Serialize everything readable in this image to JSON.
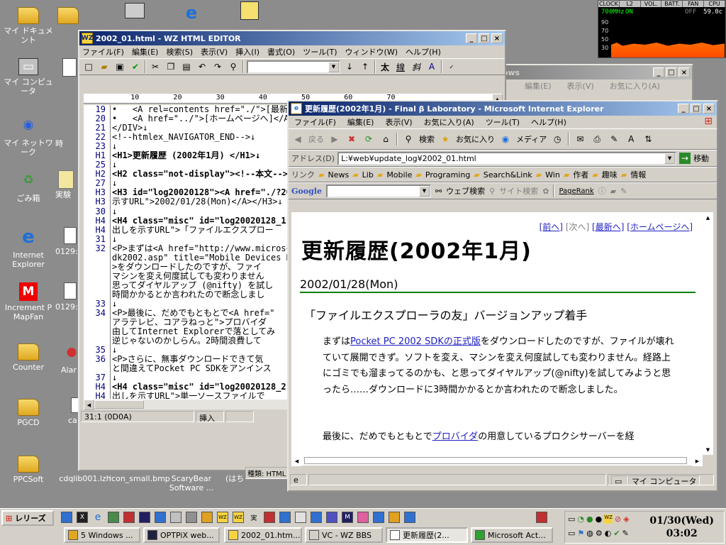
{
  "desktop": {
    "icons": [
      {
        "label": "マイ ドキュメント",
        "icon": "my-documents-icon"
      },
      {
        "label": "マイ コンピュータ",
        "icon": "my-computer-icon"
      },
      {
        "label": "マイ ネットワーク",
        "icon": "my-network-icon"
      },
      {
        "label": "ごみ箱",
        "icon": "recycle-bin-icon"
      },
      {
        "label": "Internet Explorer",
        "icon": "internet-explorer-icon"
      },
      {
        "label": "Increment P MapFan",
        "icon": "mapfan-icon"
      },
      {
        "label": "Counter",
        "icon": "folder-icon"
      },
      {
        "label": "PGCD",
        "icon": "folder-icon"
      },
      {
        "label": "PPCSoft",
        "icon": "folder-icon"
      }
    ],
    "icons2": [
      {
        "label": "時",
        "icon": "folder-icon"
      },
      {
        "label": "実験",
        "icon": "folder-icon"
      },
      {
        "label": "0129:",
        "icon": "file-icon"
      },
      {
        "label": "0129:",
        "icon": "file-icon"
      },
      {
        "label": "Alar",
        "icon": "alarm-icon"
      },
      {
        "label": "ca",
        "icon": "file-icon"
      },
      {
        "label": "cdqlib001.lzh",
        "icon": "archive-icon"
      }
    ],
    "icons3": [
      {
        "label": "icon_small.bmp",
        "icon": "bitmap-icon"
      },
      {
        "label": "ScaryBear Software ...",
        "icon": "scarybear-icon"
      },
      {
        "label": "(はち",
        "icon": "file-icon"
      }
    ]
  },
  "monitor": {
    "cols": [
      "CLOCK",
      "L2",
      "VOL.",
      "BATT.",
      "FAN",
      "CPU"
    ],
    "clock": "700MHz",
    "l2": "ON",
    "fan": "OFF",
    "cpu": "59.0c",
    "scale": [
      "90",
      "70",
      "50",
      "30"
    ]
  },
  "editor": {
    "title": "2002_01.html - WZ HTML EDITOR",
    "menu": [
      "ファイル(F)",
      "編集(E)",
      "検索(S)",
      "表示(V)",
      "挿入(I)",
      "書式(O)",
      "ツール(T)",
      "ウィンドウ(W)",
      "ヘルプ(H)"
    ],
    "ruler": "           10        20        30        40        50        60        70",
    "lines": [
      {
        "no": "19",
        "text": "•   <A rel=contents href=\"./\">[最新へ]</A>↓"
      },
      {
        "no": "20",
        "text": "•   <A href=\"../\">[ホームページへ]</A>"
      },
      {
        "no": "21",
        "text": "</DIV>↓"
      },
      {
        "no": "22",
        "text": "<!--htmlex_NAVIGATOR_END-->↓"
      },
      {
        "no": "23",
        "text": "↓"
      },
      {
        "no": "H1",
        "text": "<H1>更新履歴 (2002年1月) </H1>↓"
      },
      {
        "no": "25",
        "text": "↓"
      },
      {
        "no": "H2",
        "text": "<H2 class=\"not-display\"><!--本文-->"
      },
      {
        "no": "27",
        "text": "↓"
      },
      {
        "no": "H3",
        "text": "<H3 id=\"log20020128\"><A href=\"./?200"
      },
      {
        "no": "H3",
        "text": "示すURL\">2002/01/28(Mon)</A></H3>↓"
      },
      {
        "no": "30",
        "text": "↓"
      },
      {
        "no": "H4",
        "text": "<H4 class=\"misc\" id=\"log20020128_1\">"
      },
      {
        "no": "H4",
        "text": "出しを示すURL\">「ファイルエクスプロー"
      },
      {
        "no": "31",
        "text": "↓"
      },
      {
        "no": "32",
        "text": "<P>まずは<A href=\"http://www.microsc"
      },
      {
        "no": "",
        "text": "dk2002.asp\" title=\"Mobile Devices Do"
      },
      {
        "no": "",
        "text": ">をダウンロードしたのですが、ファイ"
      },
      {
        "no": "",
        "text": "マシンを変え何度試しても変わりません"
      },
      {
        "no": "",
        "text": "思ってダイヤルアップ (@nifty) を試し"
      },
      {
        "no": "",
        "text": "時間かかるとか言われたので断念しまし"
      },
      {
        "no": "33",
        "text": "↓"
      },
      {
        "no": "34",
        "text": "<P>最後に、だめでもともとで<A href=\""
      },
      {
        "no": "",
        "text": "アラテレビ、コアラねっと\">プロバイダ"
      },
      {
        "no": "",
        "text": "由してInternet Explorerで落としてみ"
      },
      {
        "no": "",
        "text": "逆じゃないのかしらん。2時間浪費して"
      },
      {
        "no": "35",
        "text": "↓"
      },
      {
        "no": "36",
        "text": "<P>さらに、無事ダウンロードできて気"
      },
      {
        "no": "",
        "text": "と間違えてPocket PC SDKをアンインス"
      },
      {
        "no": "37",
        "text": "↓"
      },
      {
        "no": "H4",
        "text": "<H4 class=\"misc\" id=\"log20020128_2\">"
      },
      {
        "no": "H4",
        "text": "出しを示すURL\">単一ソースファイルで"
      },
      {
        "no": "",
        "text": "</A></H4>↓"
      }
    ],
    "status": {
      "pos": "31:1 (0D0A)",
      "mode": "挿入"
    }
  },
  "back_window": {
    "title": "lows",
    "menu": [
      "編集(E)",
      "表示(V)",
      "お気に入り(A)"
    ]
  },
  "ie": {
    "title": "更新履歴(2002年1月) - Final β Laboratory - Microsoft Internet Explorer",
    "menu": [
      "ファイル(F)",
      "編集(E)",
      "表示(V)",
      "お気に入り(A)",
      "ツール(T)",
      "ヘルプ(H)"
    ],
    "toolbar": {
      "back": "戻る",
      "search": "検索",
      "favorites": "お気に入り",
      "media": "メディア"
    },
    "address_label": "アドレス(D)",
    "address": "L:¥web¥update_log¥2002_01.html",
    "go": "移動",
    "links_label": "リンク",
    "links": [
      "News",
      "Lib",
      "Mobile",
      "Programing",
      "Search&Link",
      "Win",
      "作者",
      "趣味",
      "情報"
    ],
    "google": {
      "logo": "Google",
      "web_search": "ウェブ検索",
      "site_search": "サイト検索",
      "pagerank": "PageRank"
    },
    "page": {
      "nav": {
        "prev": "[前へ]",
        "next": "[次へ]",
        "latest": "[最新へ]",
        "home": "[ホームページへ]"
      },
      "h1": "更新履歴(2002年1月)",
      "h2": "2002/01/28(Mon)",
      "h3": "「ファイルエクスプローラの友」バージョンアップ着手",
      "p1_a": "まずは",
      "p1_link": "Pocket PC 2002 SDKの正式版",
      "p1_b": "をダウンロードしたのですが、ファイルが壊れていて展開できず。ソフトを変え、マシンを変え何度試しても変わりません。経路上にゴミでも溜まってるのかも、と思ってダイヤルアップ(@nifty)を試してみようと思ったら……ダウンロードに3時間かかるとか言われたので断念しました。",
      "p2_a": "最後に、だめでもともとで",
      "p2_link": "プロバイダ",
      "p2_b": "の用意しているプロクシサーバーを経"
    },
    "status_zone": "マイ コンピュータ"
  },
  "partial_label": "種類: HTML",
  "taskbar": {
    "start": "レリーズ",
    "tasks": [
      {
        "label": "5 Windows ...",
        "active": false
      },
      {
        "label": "OPTPiX web...",
        "active": false
      },
      {
        "label": "2002_01.htm...",
        "active": false
      },
      {
        "label": "VC - WZ BBS",
        "active": false
      },
      {
        "label": "更新履歴(2...",
        "active": true
      },
      {
        "label": "Microsoft Act...",
        "active": false
      }
    ],
    "clock_date": "01/30(Wed)",
    "clock_time": "03:02"
  }
}
